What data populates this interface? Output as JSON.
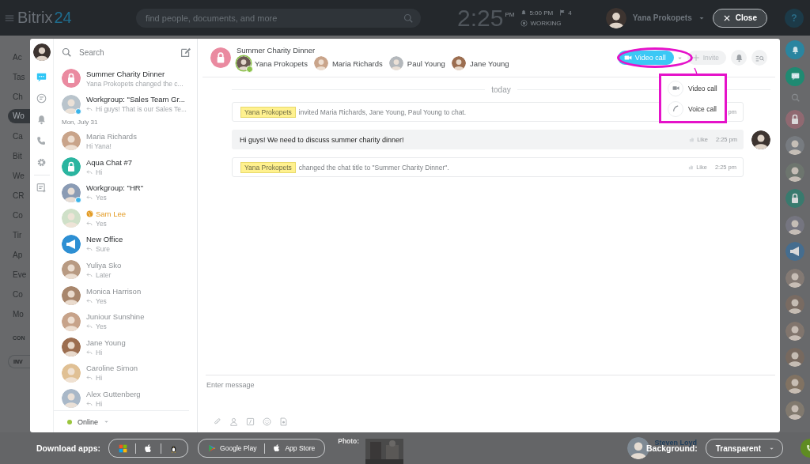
{
  "top_bar": {
    "logo": "Bitrix",
    "logo_suffix": "24",
    "search": {
      "placeholder": "find people, documents, and more"
    },
    "clock": "2:25",
    "clock_suffix": "PM",
    "alarm": "5:00 PM",
    "flags": "4",
    "work_status": "WORKING",
    "user": "Yana Prokopets",
    "close": "Close",
    "help": "?"
  },
  "background_menu": [
    {
      "kind": "item",
      "label": "Ac",
      "selected": false
    },
    {
      "kind": "item",
      "label": "Tas",
      "selected": false
    },
    {
      "kind": "item",
      "label": "Ch",
      "selected": false
    },
    {
      "kind": "item",
      "label": "Wo",
      "selected": true
    },
    {
      "kind": "item",
      "label": "Ca",
      "selected": false
    },
    {
      "kind": "item",
      "label": "Bit",
      "selected": false
    },
    {
      "kind": "item",
      "label": "We",
      "selected": false
    },
    {
      "kind": "item",
      "label": "CR",
      "selected": false
    },
    {
      "kind": "item",
      "label": "Co",
      "selected": false
    },
    {
      "kind": "item",
      "label": "Tir",
      "selected": false
    },
    {
      "kind": "item",
      "label": "Ap",
      "selected": false
    },
    {
      "kind": "item",
      "label": "Eve",
      "selected": false
    },
    {
      "kind": "item",
      "label": "Co",
      "selected": false
    },
    {
      "kind": "item",
      "label": "Mo",
      "selected": false
    },
    {
      "kind": "heading",
      "label": "CON"
    },
    {
      "kind": "button",
      "label": "INV"
    }
  ],
  "messenger": {
    "rail": [
      {
        "kind": "chat",
        "selected": true
      },
      {
        "kind": "history",
        "selected": false
      },
      {
        "kind": "bell",
        "selected": false
      },
      {
        "kind": "phone",
        "selected": false
      },
      {
        "kind": "gear",
        "selected": false
      },
      {
        "kind": "notes",
        "selected": false
      }
    ],
    "search": {
      "placeholder": "Search"
    },
    "recent": [
      {
        "kind": "chat",
        "name": "Summer Charity Dinner",
        "preview": "Yana Prokopets changed the c...",
        "replied": false,
        "offline": false,
        "extranet": false,
        "group": false,
        "avatar": {
          "kind": "lock",
          "color": "#ea8aa0"
        }
      },
      {
        "kind": "chat",
        "name": "Workgroup: \"Sales Team Gr...",
        "preview": "Hi guys! That is our Sales Te...",
        "replied": true,
        "offline": false,
        "extranet": false,
        "group": true
      },
      {
        "kind": "date",
        "name": "Mon, July 31"
      },
      {
        "kind": "chat",
        "name": "Maria Richards",
        "preview": "Hi Yana!",
        "replied": false,
        "offline": true,
        "extranet": false,
        "group": false
      },
      {
        "kind": "chat",
        "name": "Aqua Chat #7",
        "preview": "Hi",
        "replied": true,
        "offline": false,
        "extranet": false,
        "group": false,
        "avatar": {
          "kind": "lock",
          "color": "#2bb5a0"
        }
      },
      {
        "kind": "chat",
        "name": "Workgroup: \"HR\"",
        "preview": "Yes",
        "replied": true,
        "offline": false,
        "extranet": false,
        "group": true
      },
      {
        "kind": "chat",
        "name": "Sam Lee",
        "preview": "Yes",
        "replied": true,
        "offline": false,
        "extranet": true,
        "group": false
      },
      {
        "kind": "chat",
        "name": "New Office",
        "preview": "Sure",
        "replied": true,
        "offline": false,
        "extranet": false,
        "group": false,
        "avatar": {
          "kind": "megaphone",
          "color": "#2d8fd3"
        }
      },
      {
        "kind": "chat",
        "name": "Yuliya Sko",
        "preview": "Later",
        "replied": true,
        "offline": true,
        "extranet": false,
        "group": false
      },
      {
        "kind": "chat",
        "name": "Monica Harrison",
        "preview": "Yes",
        "replied": true,
        "offline": true,
        "extranet": false,
        "group": false
      },
      {
        "kind": "chat",
        "name": "Juniour Sunshine",
        "preview": "Yes",
        "replied": true,
        "offline": true,
        "extranet": false,
        "group": false
      },
      {
        "kind": "chat",
        "name": "Jane Young",
        "preview": "Hi",
        "replied": true,
        "offline": true,
        "extranet": false,
        "group": false
      },
      {
        "kind": "chat",
        "name": "Caroline Simon",
        "preview": "Hi",
        "replied": true,
        "offline": true,
        "extranet": false,
        "group": false
      },
      {
        "kind": "chat",
        "name": "Alex Guttenberg",
        "preview": "Hi",
        "replied": true,
        "offline": true,
        "extranet": false,
        "group": false
      }
    ],
    "status": {
      "label": "Online",
      "color": "#9bc53d"
    },
    "chat": {
      "title": "Summer Charity Dinner",
      "avatar": {
        "kind": "lock",
        "color": "#ea8aa0"
      },
      "members": [
        {
          "name": "Yana Prokopets",
          "owner": true,
          "color": "#6b5a52"
        },
        {
          "name": "Maria Richards",
          "owner": false,
          "color": "#c9a48a"
        },
        {
          "name": "Paul Young",
          "owner": false,
          "color": "#b4b8bc"
        },
        {
          "name": "Jane Young",
          "owner": false,
          "color": "#9c6e50"
        }
      ],
      "video_button": "Video call",
      "invite_button": {
        "label": "Invite",
        "disabled": true
      },
      "call_menu": [
        {
          "kind": "video",
          "label": "Video call"
        },
        {
          "kind": "voice",
          "label": "Voice call"
        }
      ],
      "date_divider": "today",
      "messages": [
        {
          "kind": "system",
          "author": "Yana Prokopets",
          "text": "invited Maria Richards, Jane Young, Paul Young to chat.",
          "time": "pm"
        },
        {
          "kind": "message",
          "text": "Hi guys! We need to discuss summer charity dinner!",
          "like": "Like",
          "time": "2:25 pm"
        },
        {
          "kind": "system",
          "author": "Yana Prokopets",
          "text": "changed the chat title to \"Summer Charity Dinner\".",
          "like": "Like",
          "time": "2:25 pm"
        }
      ],
      "input": {
        "placeholder": "Enter message"
      }
    }
  },
  "footer": {
    "download_label": "Download apps:",
    "stores": [
      "Google Play",
      "App Store"
    ],
    "photo_label": "Photo:",
    "person": "Steven Loyd",
    "background_label": "Background:",
    "background_value": "Transparent"
  }
}
